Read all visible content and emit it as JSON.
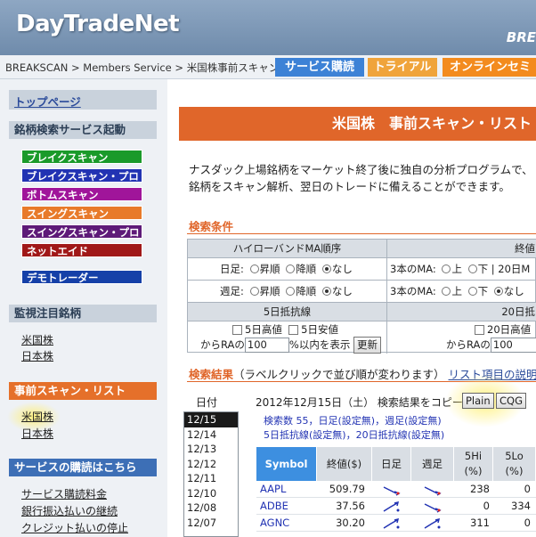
{
  "header": {
    "logo": "DayTradeNet",
    "brand_right": "BRE"
  },
  "breadcrumb": "BREAKSCAN > Members Service > 米国株事前スキャン",
  "nav": [
    "サービス購読",
    "トライアル",
    "オンラインセミ"
  ],
  "sidebar": {
    "top_link": "トップページ",
    "search_title": "銘柄検索サービス起動",
    "services": [
      "ブレイクスキャン",
      "ブレイクスキャン・プロ",
      "ボトムスキャン",
      "スイングスキャン",
      "スイングスキャン・プロ",
      "ネットエイド"
    ],
    "demo": "デモトレーダー",
    "watch_title": "監視注目銘柄",
    "watch_links": [
      "米国株",
      "日本株"
    ],
    "prescan_title": "事前スキャン・リスト",
    "prescan_links": [
      "米国株",
      "日本株"
    ],
    "subscribe_title": "サービスの購読はこちら",
    "subscribe_links": [
      "サービス購読料金",
      "銀行振込払いの継続",
      "クレジット払いの停止"
    ]
  },
  "main": {
    "title": "米国株　事前スキャン・リスト",
    "intro": [
      "ナスダック上場銘柄をマーケット終了後に独自の分析プログラムで、トレンド",
      "銘柄をスキャン解析、翌日のトレードに備えることができます。"
    ],
    "criteria_title": "検索条件",
    "criteria": {
      "h1_left": "ハイローバンドMA順序",
      "h1_right": "終値",
      "daily": "日足:",
      "weekly": "週足:",
      "opt_up": "昇順",
      "opt_down": "降順",
      "opt_none": "なし",
      "ma3": "3本のMA:",
      "opt_above": "上",
      "opt_below": "下",
      "ma20": "20日M",
      "h2_left": "5日抵抗線",
      "h2_right": "20日抵",
      "hi5": "5日高値",
      "lo5": "5日安値",
      "hi20": "20日高値",
      "from_ra": "からRAの",
      "val100": "100",
      "within": "%以内を表示",
      "update": "更新"
    },
    "results_title": "検索結果",
    "results_note": "（ラベルクリックで並び順が変わります）",
    "results_link": "リスト項目の説明",
    "date_label": "日付",
    "dates": [
      "12/15",
      "12/14",
      "12/13",
      "12/12",
      "12/11",
      "12/10",
      "12/08",
      "12/07"
    ],
    "result_date": "2012年12月15日（土）",
    "copy_label": "検索結果をコピー",
    "btn_plain": "Plain",
    "btn_cqg": "CQG",
    "meta1": "検索数 55，日足(設定無)，週足(設定無)",
    "meta2": "5日抵抗線(設定無)，20日抵抗線(設定無)",
    "columns": [
      "Symbol",
      "終値($)",
      "日足",
      "週足",
      "5Hi\n(%)",
      "5Lo\n(%)"
    ],
    "rows": [
      {
        "symbol": "AAPL",
        "close": "509.79",
        "hi": "238",
        "lo": "0"
      },
      {
        "symbol": "ADBE",
        "close": "37.56",
        "hi": "0",
        "lo": "334"
      },
      {
        "symbol": "AGNC",
        "close": "30.20",
        "hi": "311",
        "lo": "0"
      }
    ]
  }
}
